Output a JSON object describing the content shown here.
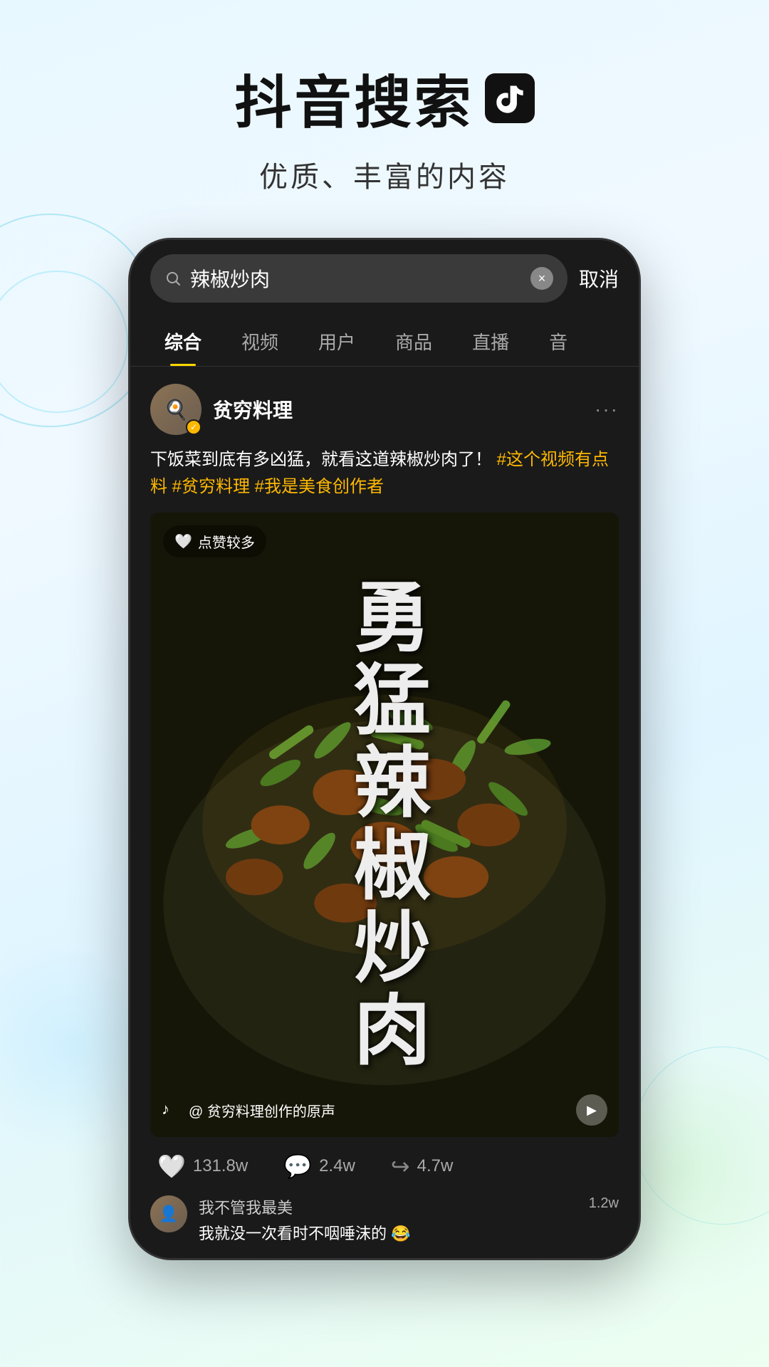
{
  "page": {
    "background": "light-gradient"
  },
  "header": {
    "title": "抖音搜索",
    "logo_symbol": "♪",
    "subtitle": "优质、丰富的内容"
  },
  "phone": {
    "search_bar": {
      "query": "辣椒炒肉",
      "clear_label": "×",
      "cancel_label": "取消"
    },
    "tabs": [
      {
        "label": "综合",
        "active": true
      },
      {
        "label": "视频",
        "active": false
      },
      {
        "label": "用户",
        "active": false
      },
      {
        "label": "商品",
        "active": false
      },
      {
        "label": "直播",
        "active": false
      },
      {
        "label": "音",
        "active": false
      }
    ],
    "post": {
      "username": "贫穷料理",
      "verified": true,
      "description_plain": "下饭菜到底有多凶猛，就看这道辣椒炒肉了！",
      "description_tags": "#这个视频有点料 #贫穷料理 #我是美食创作者",
      "video": {
        "like_badge": "点赞较多",
        "overlay_text": "勇猛辣椒炒肉",
        "sound_text": "@ 贫穷料理创作的原声",
        "play_icon": "▶"
      },
      "interactions": {
        "likes": "131.8w",
        "comments": "2.4w",
        "shares": "4.7w"
      }
    },
    "comment": {
      "username": "我不管我最美",
      "text": "我就没一次看时不咽唾沫的 😂",
      "likes": "1.2w"
    }
  }
}
